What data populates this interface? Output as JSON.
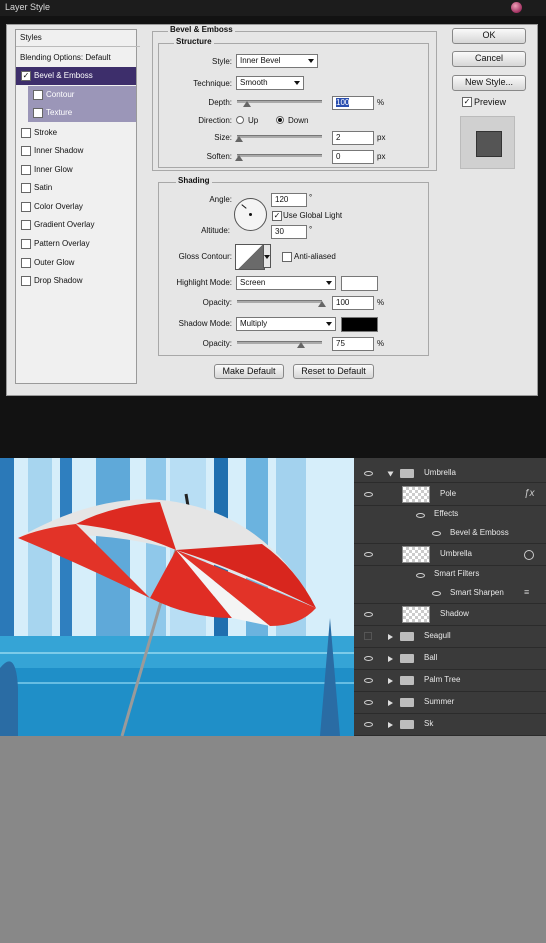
{
  "dialog": {
    "title": "Layer Style",
    "styles_header": "Styles",
    "blending_options": "Blending Options: Default",
    "style_items": [
      {
        "label": "Bevel & Emboss",
        "checked": true,
        "state": "selected"
      },
      {
        "label": "Contour",
        "checked": false,
        "state": "sub"
      },
      {
        "label": "Texture",
        "checked": false,
        "state": "sub"
      },
      {
        "label": "Stroke",
        "checked": false,
        "state": "normal"
      },
      {
        "label": "Inner Shadow",
        "checked": false,
        "state": "normal"
      },
      {
        "label": "Inner Glow",
        "checked": false,
        "state": "normal"
      },
      {
        "label": "Satin",
        "checked": false,
        "state": "normal"
      },
      {
        "label": "Color Overlay",
        "checked": false,
        "state": "normal"
      },
      {
        "label": "Gradient Overlay",
        "checked": false,
        "state": "normal"
      },
      {
        "label": "Pattern Overlay",
        "checked": false,
        "state": "normal"
      },
      {
        "label": "Outer Glow",
        "checked": false,
        "state": "normal"
      },
      {
        "label": "Drop Shadow",
        "checked": false,
        "state": "normal"
      }
    ],
    "bevel": {
      "group_title": "Bevel & Emboss",
      "structure_title": "Structure",
      "style_label": "Style:",
      "style_value": "Inner Bevel",
      "technique_label": "Technique:",
      "technique_value": "Smooth",
      "depth_label": "Depth:",
      "depth_value": "100",
      "depth_unit": "%",
      "direction_label": "Direction:",
      "direction_up": "Up",
      "direction_down": "Down",
      "size_label": "Size:",
      "size_value": "2",
      "size_unit": "px",
      "soften_label": "Soften:",
      "soften_value": "0",
      "soften_unit": "px"
    },
    "shading": {
      "title": "Shading",
      "angle_label": "Angle:",
      "angle_value": "120",
      "degree": "°",
      "use_global_light": "Use Global Light",
      "altitude_label": "Altitude:",
      "altitude_value": "30",
      "gloss_label": "Gloss Contour:",
      "anti_aliased": "Anti-aliased",
      "highlight_label": "Highlight Mode:",
      "highlight_value": "Screen",
      "opacity_label": "Opacity:",
      "highlight_opacity": "100",
      "percent": "%",
      "shadow_label": "Shadow Mode:",
      "shadow_value": "Multiply",
      "shadow_opacity": "75",
      "highlight_color": "#ffffff",
      "shadow_color": "#000000"
    },
    "make_default": "Make Default",
    "reset_default": "Reset to Default",
    "ok": "OK",
    "cancel": "Cancel",
    "new_style": "New Style...",
    "preview": "Preview"
  },
  "layers": {
    "rows": [
      {
        "name": "Umbrella",
        "kind": "group-open"
      },
      {
        "name": "Pole",
        "kind": "layer",
        "fx": "fx"
      },
      {
        "name": "Effects",
        "kind": "sub"
      },
      {
        "name": "Bevel & Emboss",
        "kind": "subsub"
      },
      {
        "name": "Umbrella",
        "kind": "smart"
      },
      {
        "name": "Smart Filters",
        "kind": "sub"
      },
      {
        "name": "Smart Sharpen",
        "kind": "subsub"
      },
      {
        "name": "Shadow",
        "kind": "layer"
      },
      {
        "name": "Seagull",
        "kind": "group"
      },
      {
        "name": "Ball",
        "kind": "group"
      },
      {
        "name": "Palm Tree",
        "kind": "group"
      },
      {
        "name": "Summer",
        "kind": "group"
      },
      {
        "name": "Sk",
        "kind": "group"
      }
    ]
  }
}
